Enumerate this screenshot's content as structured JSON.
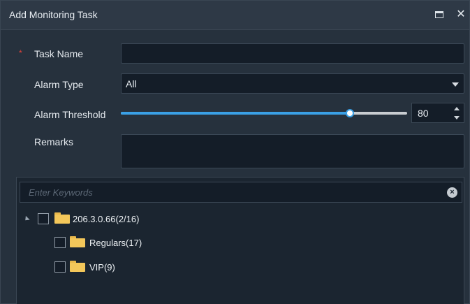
{
  "dialog": {
    "title": "Add Monitoring Task"
  },
  "form": {
    "task_name_label": "Task Name",
    "required_mark": "*",
    "task_name_value": "",
    "alarm_type_label": "Alarm Type",
    "alarm_type_value": "All",
    "alarm_threshold_label": "Alarm Threshold",
    "alarm_threshold_value": "80",
    "alarm_threshold_max": 100,
    "remarks_label": "Remarks",
    "remarks_value": ""
  },
  "search": {
    "placeholder": "Enter Keywords"
  },
  "tree": {
    "root": {
      "label": "206.3.0.66(2/16)",
      "expanded": true,
      "checked": false
    },
    "children": [
      {
        "label": "Regulars(17)",
        "checked": false
      },
      {
        "label": "VIP(9)",
        "checked": false
      }
    ]
  },
  "colors": {
    "accent": "#3aa0e6",
    "required": "#e0423a",
    "folder": "#f3c75a"
  }
}
